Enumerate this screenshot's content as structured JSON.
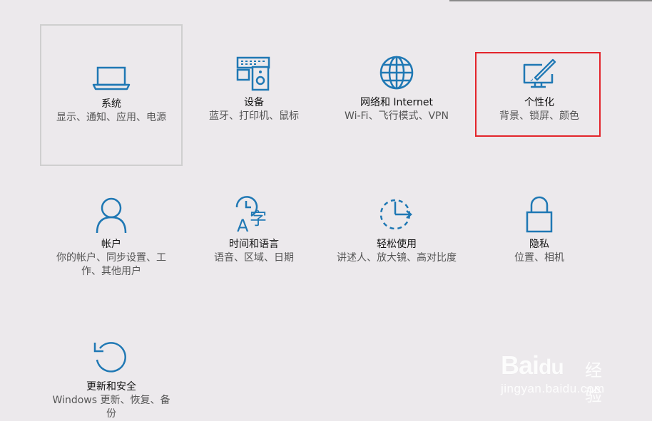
{
  "tiles": [
    {
      "title": "系统",
      "desc": "显示、通知、应用、电源",
      "icon": "laptop-icon"
    },
    {
      "title": "设备",
      "desc": "蓝牙、打印机、鼠标",
      "icon": "devices-icon"
    },
    {
      "title": "网络和 Internet",
      "desc": "Wi-Fi、飞行模式、VPN",
      "icon": "globe-icon"
    },
    {
      "title": "个性化",
      "desc": "背景、锁屏、颜色",
      "icon": "personalization-icon"
    },
    {
      "title": "帐户",
      "desc": "你的帐户、同步设置、工作、其他用户",
      "icon": "person-icon"
    },
    {
      "title": "时间和语言",
      "desc": "语音、区域、日期",
      "icon": "time-language-icon"
    },
    {
      "title": "轻松使用",
      "desc": "讲述人、放大镜、高对比度",
      "icon": "ease-of-access-icon"
    },
    {
      "title": "隐私",
      "desc": "位置、相机",
      "icon": "lock-icon"
    },
    {
      "title": "更新和安全",
      "desc": "Windows 更新、恢复、备份",
      "icon": "update-icon"
    }
  ],
  "accent_color": "#1f78b4",
  "highlight_color": "#e3242b",
  "watermark": {
    "logo": "Bai经验",
    "jingyan": "经验",
    "url": "jingyan.baidu.com"
  }
}
